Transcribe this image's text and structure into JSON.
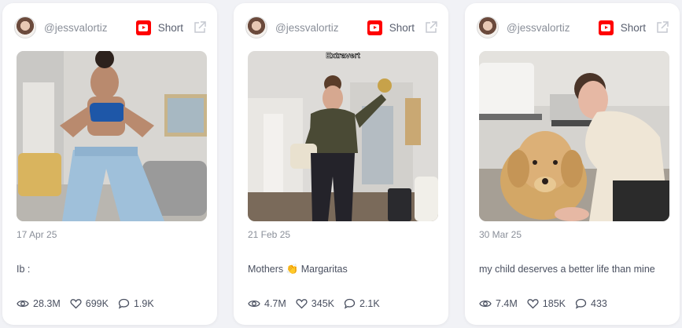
{
  "cards": [
    {
      "handle": "@jessvalortiz",
      "type_label": "Short",
      "date": "17 Apr 25",
      "caption": "Ib :",
      "views": "28.3M",
      "likes": "699K",
      "comments": "1.9K"
    },
    {
      "handle": "@jessvalortiz",
      "type_label": "Short",
      "date": "21 Feb 25",
      "caption_before": "Mothers",
      "caption_emoji": "👏",
      "caption_after": "Margaritas",
      "overlay_text": "Extravert",
      "views": "4.7M",
      "likes": "345K",
      "comments": "2.1K"
    },
    {
      "handle": "@jessvalortiz",
      "type_label": "Short",
      "date": "30 Mar 25",
      "caption": "my child deserves a better life than mine",
      "views": "7.4M",
      "likes": "185K",
      "comments": "433"
    }
  ],
  "icons": {
    "platform": "youtube-icon",
    "open": "external-link-icon",
    "views": "eye-icon",
    "likes": "heart-icon",
    "comments": "comment-icon"
  },
  "colors": {
    "youtube_red": "#ff0000",
    "muted_text": "#8a8f99",
    "body_text": "#4a5060",
    "background": "#f1f2f6"
  }
}
